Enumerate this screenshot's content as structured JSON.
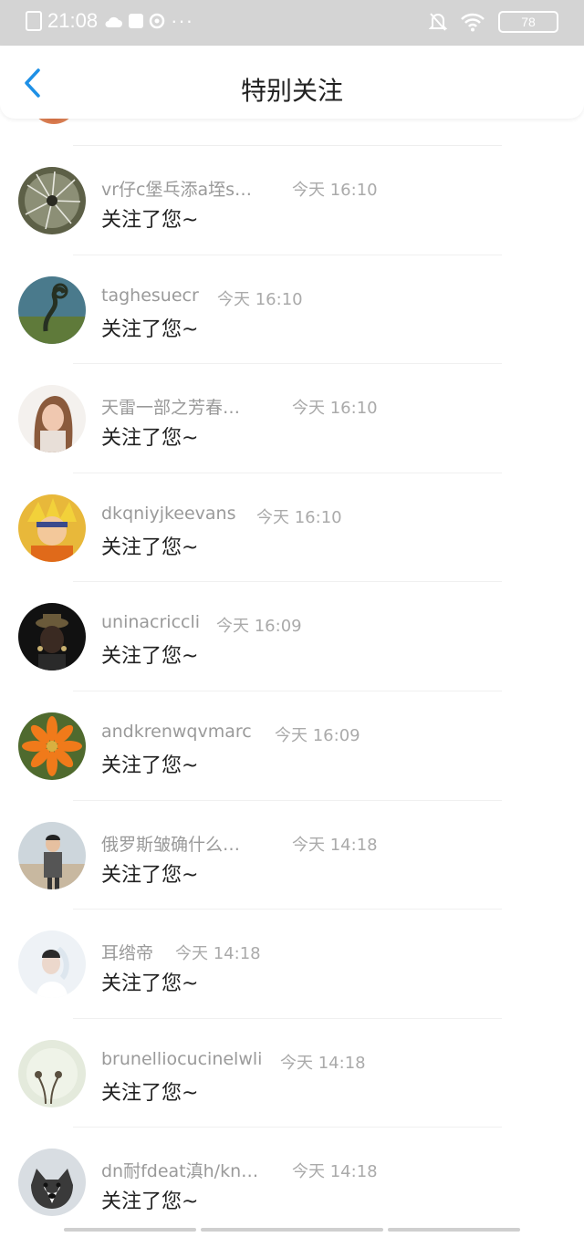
{
  "status_bar": {
    "time": "21:08",
    "dots": "···",
    "battery": "78"
  },
  "header": {
    "title": "特别关注"
  },
  "notifications": [
    {
      "name": "vr仔c堡乓添a垤s…",
      "time": "今天 16:10",
      "message": "关注了您~"
    },
    {
      "name": "taghesuecr",
      "time": "今天 16:10",
      "message": "关注了您~"
    },
    {
      "name": "天雷一部之芳春…",
      "time": "今天 16:10",
      "message": "关注了您~"
    },
    {
      "name": "dkqniyjkeevans",
      "time": "今天 16:10",
      "message": "关注了您~"
    },
    {
      "name": "uninacriccli",
      "time": "今天 16:09",
      "message": "关注了您~"
    },
    {
      "name": "andkrenwqvmarc",
      "time": "今天 16:09",
      "message": "关注了您~"
    },
    {
      "name": "俄罗斯皱确什么…",
      "time": "今天 14:18",
      "message": "关注了您~"
    },
    {
      "name": "耳绺帝",
      "time": "今天 14:18",
      "message": "关注了您~"
    },
    {
      "name": "brunelliocucinelwli",
      "time": "今天 14:18",
      "message": "关注了您~"
    },
    {
      "name": "dn耐fdeat滇h/kn…",
      "time": "今天 14:18",
      "message": "关注了您~"
    }
  ],
  "colors": {
    "accent": "#1e90e6",
    "status_bar_bg": "#d4d4d4",
    "name_text": "#9a9a9a",
    "message_text": "#222222"
  }
}
